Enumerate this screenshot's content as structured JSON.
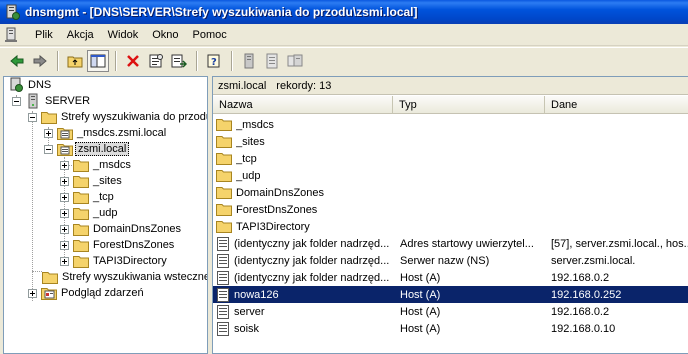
{
  "window": {
    "title": "dnsmgmt - [DNS\\SERVER\\Strefy wyszukiwania do przodu\\zsmi.local]"
  },
  "menu": [
    "Plik",
    "Akcja",
    "Widok",
    "Okno",
    "Pomoc"
  ],
  "tree": {
    "root": "DNS",
    "server": "SERVER",
    "forward_zones": "Strefy wyszukiwania do przodu",
    "msdcs_zone": "_msdcs.zsmi.local",
    "zone": "zsmi.local",
    "zone_children": [
      "_msdcs",
      "_sites",
      "_tcp",
      "_udp",
      "DomainDnsZones",
      "ForestDnsZones",
      "TAPI3Directory"
    ],
    "reverse_zones": "Strefy wyszukiwania wsteczneg",
    "event_viewer": "Podgląd zdarzeń"
  },
  "right": {
    "zone_name": "zsmi.local",
    "records_label": "rekordy: 13",
    "columns": [
      "Nazwa",
      "Typ",
      "Dane"
    ],
    "rows": [
      {
        "name": "_msdcs",
        "type": "",
        "data": "",
        "icon": "folder-icon"
      },
      {
        "name": "_sites",
        "type": "",
        "data": "",
        "icon": "folder-icon"
      },
      {
        "name": "_tcp",
        "type": "",
        "data": "",
        "icon": "folder-icon"
      },
      {
        "name": "_udp",
        "type": "",
        "data": "",
        "icon": "folder-icon"
      },
      {
        "name": "DomainDnsZones",
        "type": "",
        "data": "",
        "icon": "folder-icon"
      },
      {
        "name": "ForestDnsZones",
        "type": "",
        "data": "",
        "icon": "folder-icon"
      },
      {
        "name": "TAPI3Directory",
        "type": "",
        "data": "",
        "icon": "folder-icon"
      },
      {
        "name": "(identyczny jak folder nadrzęd...",
        "type": "Adres startowy uwierzytel...",
        "data": "[57], server.zsmi.local., hos...",
        "icon": "record-icon"
      },
      {
        "name": "(identyczny jak folder nadrzęd...",
        "type": "Serwer nazw (NS)",
        "data": "server.zsmi.local.",
        "icon": "record-icon"
      },
      {
        "name": "(identyczny jak folder nadrzęd...",
        "type": "Host (A)",
        "data": "192.168.0.2",
        "icon": "record-icon"
      },
      {
        "name": "nowa126",
        "type": "Host (A)",
        "data": "192.168.0.252",
        "icon": "record-icon",
        "selected": true
      },
      {
        "name": "server",
        "type": "Host (A)",
        "data": "192.168.0.2",
        "icon": "record-icon"
      },
      {
        "name": "soisk",
        "type": "Host (A)",
        "data": "192.168.0.10",
        "icon": "record-icon"
      }
    ]
  },
  "colors": {
    "title_bar": "#0053dc",
    "selection": "#0a246a",
    "folder": "#f5d36b"
  }
}
